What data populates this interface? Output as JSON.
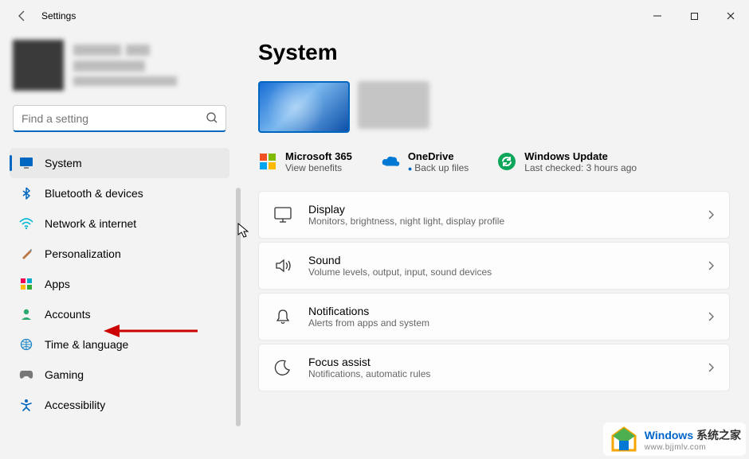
{
  "app_title": "Settings",
  "search": {
    "placeholder": "Find a setting"
  },
  "sidebar": {
    "items": [
      {
        "label": "System",
        "icon": "monitor"
      },
      {
        "label": "Bluetooth & devices",
        "icon": "bluetooth"
      },
      {
        "label": "Network & internet",
        "icon": "wifi"
      },
      {
        "label": "Personalization",
        "icon": "brush"
      },
      {
        "label": "Apps",
        "icon": "apps"
      },
      {
        "label": "Accounts",
        "icon": "person"
      },
      {
        "label": "Time & language",
        "icon": "globe-clock"
      },
      {
        "label": "Gaming",
        "icon": "gamepad"
      },
      {
        "label": "Accessibility",
        "icon": "accessibility"
      }
    ]
  },
  "page": {
    "title": "System",
    "status": {
      "m365": {
        "title": "Microsoft 365",
        "sub": "View benefits"
      },
      "onedrive": {
        "title": "OneDrive",
        "sub": "Back up files"
      },
      "update": {
        "title": "Windows Update",
        "sub": "Last checked: 3 hours ago"
      }
    },
    "cards": [
      {
        "title": "Display",
        "sub": "Monitors, brightness, night light, display profile",
        "icon": "display"
      },
      {
        "title": "Sound",
        "sub": "Volume levels, output, input, sound devices",
        "icon": "sound"
      },
      {
        "title": "Notifications",
        "sub": "Alerts from apps and system",
        "icon": "bell"
      },
      {
        "title": "Focus assist",
        "sub": "Notifications, automatic rules",
        "icon": "moon"
      }
    ]
  },
  "watermark": {
    "brand": "Windows",
    "brand_cn": "系统之家",
    "url": "www.bjjmlv.com"
  }
}
